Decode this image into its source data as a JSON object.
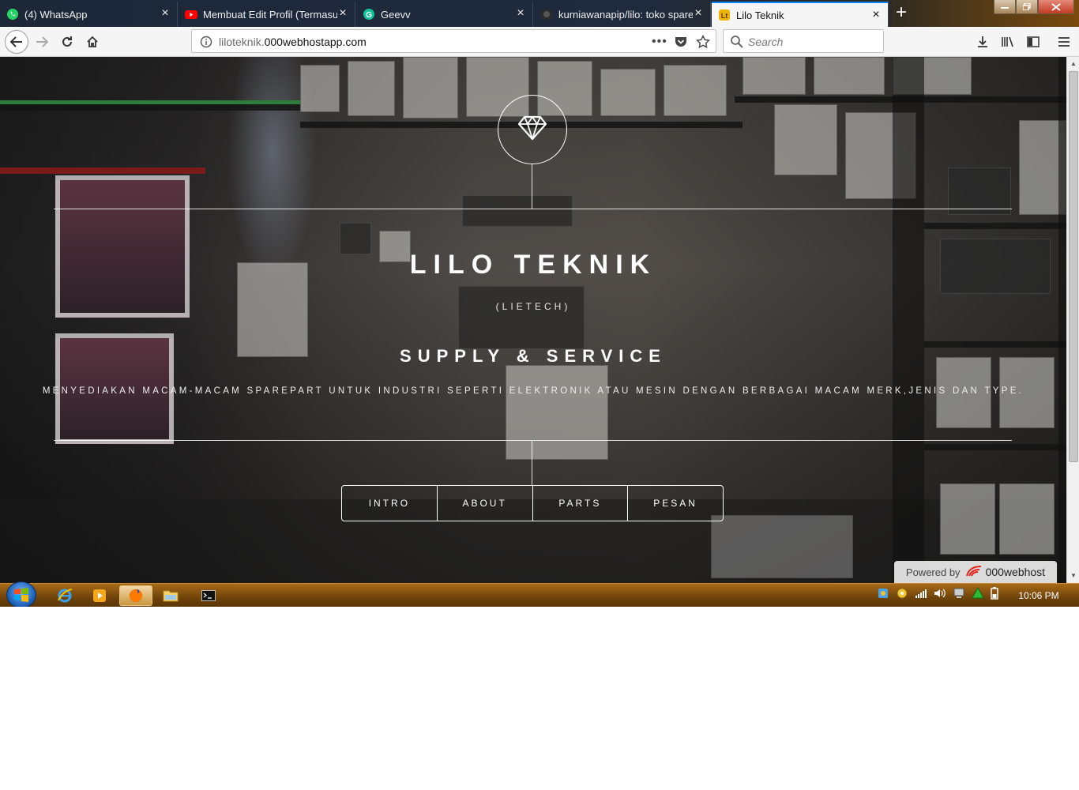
{
  "browser": {
    "tabs": [
      {
        "label": "(4) WhatsApp",
        "icon": "whatsapp-icon",
        "active": false
      },
      {
        "label": "Membuat Edit Profil (Termasuk",
        "icon": "youtube-icon",
        "active": false
      },
      {
        "label": "Geevv",
        "icon": "grammarly-icon",
        "active": false
      },
      {
        "label": "kurniawanapip/lilo: toko sparep",
        "icon": "github-icon",
        "active": false
      },
      {
        "label": "Lilo Teknik",
        "icon": "site-favicon-icon",
        "active": true
      }
    ],
    "url_dim": "liloteknik.",
    "url_main": "000webhostapp.com",
    "search_placeholder": "Search"
  },
  "site": {
    "logo_icon": "diamond-icon",
    "title": "LILO TEKNIK",
    "subtitle": "(LIETECH)",
    "heading": "SUPPLY & SERVICE",
    "description": "MENYEDIAKAN MACAM-MACAM SPAREPART UNTUK INDUSTRI SEPERTI ELEKTRONIK ATAU MESIN DENGAN BERBAGAI MACAM MERK,JENIS DAN TYPE.",
    "nav": [
      "INTRO",
      "ABOUT",
      "PARTS",
      "PESAN"
    ],
    "powered_by": "Powered by",
    "powered_brand": "000webhost"
  },
  "taskbar": {
    "clock": "10:06 PM",
    "apps": [
      "internet-explorer-icon",
      "media-player-icon",
      "firefox-icon",
      "file-explorer-icon",
      "command-prompt-icon"
    ]
  },
  "colors": {
    "tab_accent": "#0a84ff",
    "tabstrip": "#1f2a3d",
    "taskbar": "#8a5410"
  }
}
